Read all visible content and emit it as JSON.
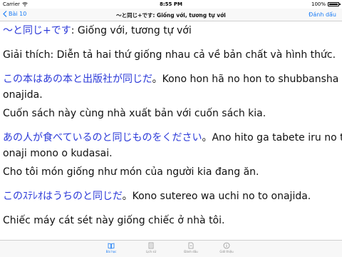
{
  "status_bar": {
    "carrier": "Carrier",
    "time": "8:55 PM",
    "battery": "100%",
    "battery_level": 1.0
  },
  "nav": {
    "back_label": "Bài 10",
    "title": "〜と同じ+です: Giống với, tương tự với",
    "bookmark_label": "Đánh dấu"
  },
  "content": {
    "heading": "〜と同じ+です: Giống với, tương tự với",
    "explanation": "Giải thích: Diễn tả hai thứ giống nhau cả về bản chất và hình thức.",
    "examples": [
      {
        "jp": "この本はあの本と出版社が同じだ",
        "romaji_line1": "。Kono hon hã no hon to shubbansha ga",
        "romaji_line2": "onajida.",
        "vi": "Cuốn sách này cùng nhà xuất bản với cuốn sách kia."
      },
      {
        "jp": "あの人が食べているのと同じものをください",
        "romaji_line1": "。Ano hito ga tabete iru no to",
        "romaji_line2": "onaji mono o kudasai.",
        "vi": "Cho tôi món giống như món của người kia đang ăn."
      },
      {
        "jp": "このｽﾃﾚｵはうちのと同じだ",
        "romaji_line1": "。Kono sutereo wa uchi no to onajida.",
        "vi": "Chiếc máy cát sét này giống chiếc ở nhà tôi."
      }
    ]
  },
  "tabs": [
    {
      "label": "Bài học",
      "icon": "book-icon",
      "active": true
    },
    {
      "label": "Lịch sử",
      "icon": "history-icon",
      "active": false
    },
    {
      "label": "Đánh dấu",
      "icon": "bookmark-icon",
      "active": false
    },
    {
      "label": "Giới thiệu",
      "icon": "info-icon",
      "active": false
    }
  ],
  "colors": {
    "accent": "#1a7cf5",
    "japanese_text": "#2b39d8"
  }
}
